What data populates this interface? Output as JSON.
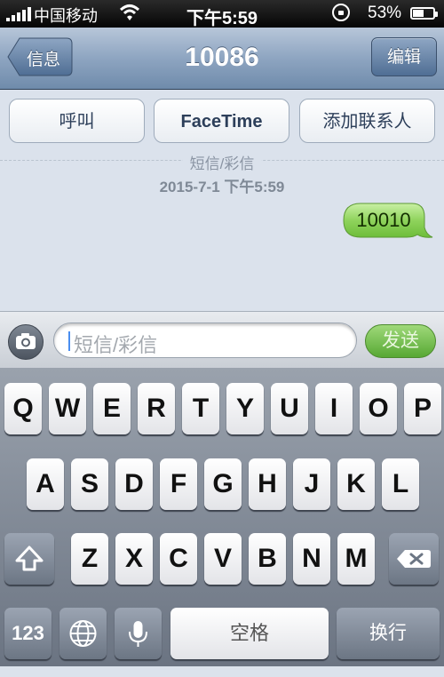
{
  "status": {
    "carrier": "中国移动",
    "time": "下午5:59",
    "battery_percent": "53%",
    "battery_level": 0.53
  },
  "nav": {
    "back_label": "信息",
    "title": "10086",
    "edit_label": "编辑"
  },
  "actions": {
    "call": "呼叫",
    "facetime": "FaceTime",
    "add_contact": "添加联系人"
  },
  "conversation": {
    "type_label": "短信/彩信",
    "timestamp": "2015-7-1 下午5:59",
    "messages": [
      {
        "direction": "outgoing",
        "text": "10010",
        "color": "#8fd35c"
      }
    ]
  },
  "composer": {
    "placeholder": "短信/彩信",
    "send_label": "发送"
  },
  "keyboard": {
    "row1": [
      "Q",
      "W",
      "E",
      "R",
      "T",
      "Y",
      "U",
      "I",
      "O",
      "P"
    ],
    "row2": [
      "A",
      "S",
      "D",
      "F",
      "G",
      "H",
      "J",
      "K",
      "L"
    ],
    "row3": [
      "Z",
      "X",
      "C",
      "V",
      "B",
      "N",
      "M"
    ],
    "numbers_label": "123",
    "space_label": "空格",
    "return_label": "换行"
  },
  "colors": {
    "nav": "#8ea5c1",
    "send": "#57a833",
    "bubble": "#8fd35c"
  }
}
